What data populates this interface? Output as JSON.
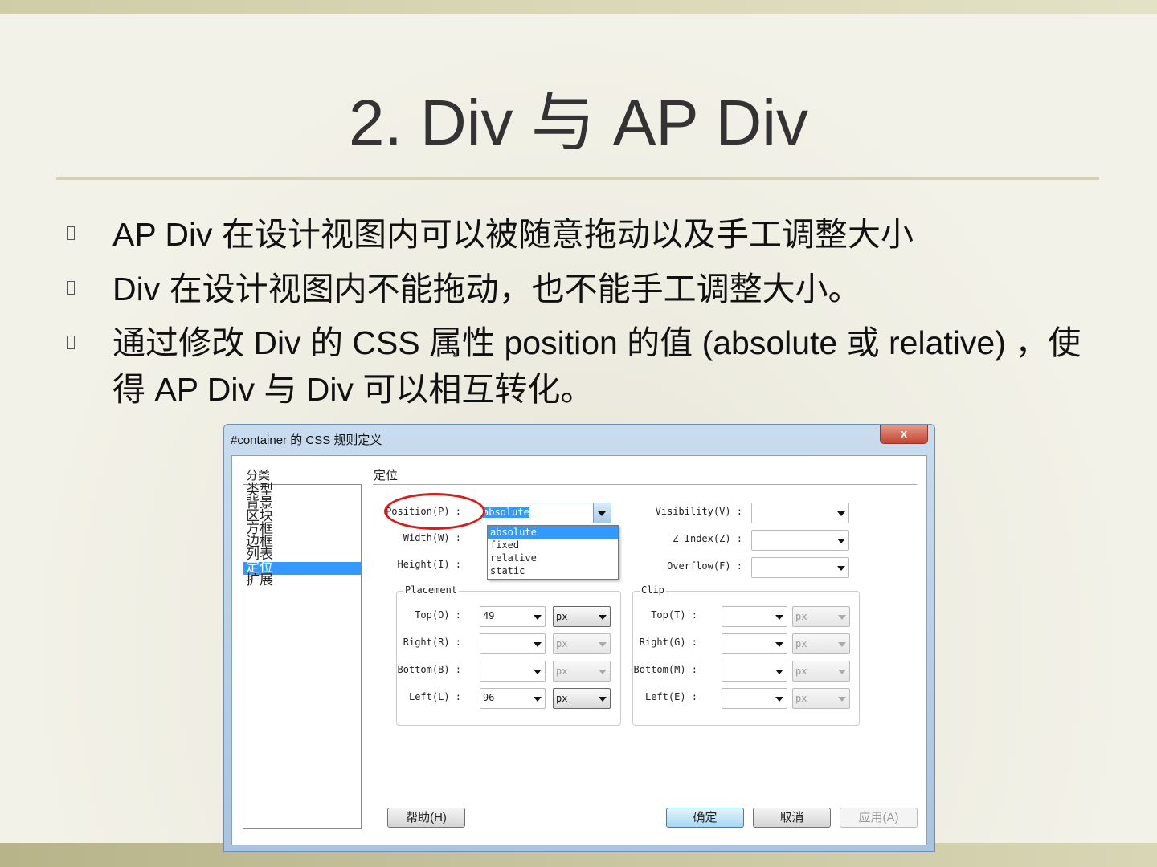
{
  "slide": {
    "title": "2. Div 与 AP Div",
    "bullets": [
      "AP Div 在设计视图内可以被随意拖动以及手工调整大小",
      "Div 在设计视图内不能拖动，也不能手工调整大小。",
      "通过修改 Div 的 CSS 属性 position 的值 (absolute 或 relative) ，使得 AP Div 与 Div 可以相互转化。"
    ]
  },
  "dialog": {
    "title": "#container 的 CSS 规则定义",
    "close": "x",
    "category_label": "分类",
    "categories": [
      "类型",
      "背景",
      "区块",
      "方框",
      "边框",
      "列表",
      "定位",
      "扩展"
    ],
    "selected_category": "定位",
    "section_title": "定位",
    "position": {
      "label": "Position(P) :",
      "value": "absolute",
      "options": [
        "absolute",
        "fixed",
        "relative",
        "static"
      ]
    },
    "width_label": "Width(W) :",
    "height_label": "Height(I) :",
    "visibility": {
      "label": "Visibility(V) :",
      "value": ""
    },
    "zindex": {
      "label": "Z-Index(Z) :",
      "value": ""
    },
    "overflow": {
      "label": "Overflow(F) :",
      "value": ""
    },
    "placement": {
      "legend": "Placement",
      "rows": [
        {
          "label": "Top(O) :",
          "value": "49",
          "unit": "px"
        },
        {
          "label": "Right(R) :",
          "value": "",
          "unit": "px"
        },
        {
          "label": "Bottom(B) :",
          "value": "",
          "unit": "px"
        },
        {
          "label": "Left(L) :",
          "value": "96",
          "unit": "px"
        }
      ]
    },
    "clip": {
      "legend": "Clip",
      "rows": [
        {
          "label": "Top(T) :",
          "value": "",
          "unit": "px"
        },
        {
          "label": "Right(G) :",
          "value": "",
          "unit": "px"
        },
        {
          "label": "Bottom(M) :",
          "value": "",
          "unit": "px"
        },
        {
          "label": "Left(E) :",
          "value": "",
          "unit": "px"
        }
      ]
    },
    "buttons": {
      "help": "帮助(H)",
      "ok": "确定",
      "cancel": "取消",
      "apply": "应用(A)"
    }
  },
  "colors": {
    "highlight": "#3399ff",
    "annotation": "#e01818"
  }
}
